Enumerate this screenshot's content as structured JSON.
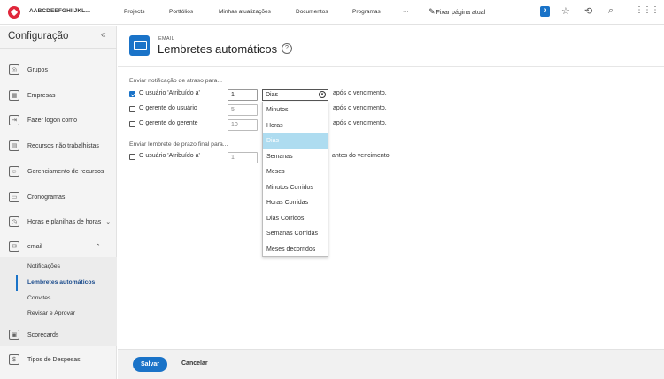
{
  "topbar": {
    "org_name": "AABCDEEFGHIIJKL...",
    "nav": [
      "Projects",
      "Portfólios",
      "Minhas atualizações",
      "Documentos",
      "Programas",
      "···"
    ],
    "pin_label": "Fixar página atual",
    "badge_count": "9",
    "icons": [
      "star-icon",
      "history-icon",
      "search-icon",
      "grid-icon"
    ]
  },
  "sidebar": {
    "title": "Configuração",
    "collapse_glyph": "«",
    "items": [
      {
        "label": "Grupos",
        "icon": "groups-icon"
      },
      {
        "label": "Empresas",
        "icon": "companies-icon"
      },
      {
        "label": "Fazer logon como",
        "icon": "login-as-icon"
      },
      {
        "label": "Recursos não trabalhistas",
        "icon": "non-labor-icon"
      },
      {
        "label": "Gerenciamento de recursos",
        "icon": "resource-mgmt-icon"
      },
      {
        "label": "Cronogramas",
        "icon": "schedules-icon"
      },
      {
        "label": "Horas e planilhas de horas",
        "icon": "timesheets-icon"
      },
      {
        "label": "email",
        "icon": "email-icon"
      }
    ],
    "email_sub": [
      "Notificações",
      "Lembretes automáticos",
      "Convites",
      "Revisar e Aprovar"
    ],
    "bottom_items": [
      {
        "label": "Scorecards",
        "icon": "scorecards-icon"
      },
      {
        "label": "Tipos de Despesas",
        "icon": "expense-types-icon"
      }
    ]
  },
  "header": {
    "kicker": "EMAIL",
    "title": "Lembretes automáticos",
    "help": "?"
  },
  "late_section": {
    "label": "Enviar notificação de atraso para...",
    "rows": [
      {
        "label": "O usuário 'Atribuído a'",
        "checked": true,
        "value": "1",
        "tail": "após o vencimento."
      },
      {
        "label": "O gerente do usuário",
        "checked": false,
        "value": "5",
        "tail": "após o vencimento."
      },
      {
        "label": "O gerente do gerente",
        "checked": false,
        "value": "10",
        "tail": "após o vencimento."
      }
    ]
  },
  "due_section": {
    "label": "Enviar lembrete de prazo final para...",
    "rows": [
      {
        "label": "O usuário 'Atribuído a'",
        "checked": false,
        "value": "1",
        "tail": "antes do vencimento."
      }
    ]
  },
  "unit_select": {
    "value": "Dias",
    "options": [
      "Minutos",
      "Horas",
      "Dias",
      "Semanas",
      "Meses",
      "Minutos Corridos",
      "Horas Corridas",
      "Dias Corridos",
      "Semanas Corridas",
      "Meses decorridos"
    ],
    "selected_index": 2
  },
  "footer": {
    "save": "Salvar",
    "cancel": "Cancelar"
  },
  "colors": {
    "accent": "#1a73c8",
    "highlight": "#aedcf0",
    "logo": "#e0263b"
  }
}
